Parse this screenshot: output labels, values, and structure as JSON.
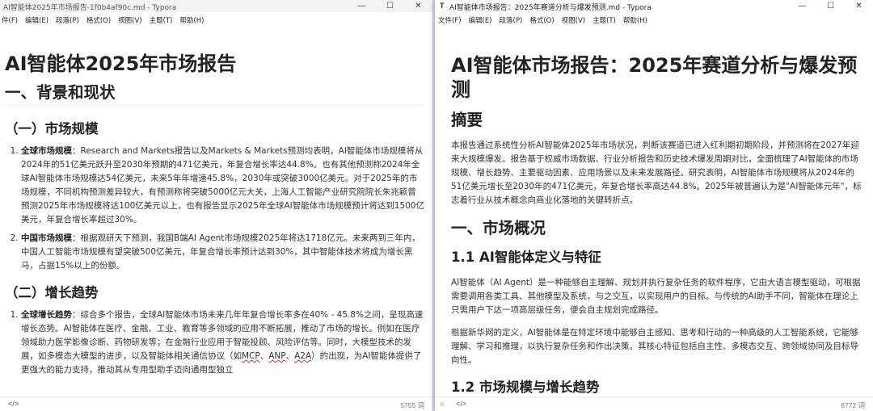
{
  "left_window": {
    "title": "AI智能体2025年市场报告-1f0b4af90c.md - Typora",
    "menu": [
      "件(F)",
      "编辑(E)",
      "段落(P)",
      "格式(O)",
      "视图(V)",
      "主题(T)",
      "帮助(H)"
    ],
    "doc": {
      "h1": "AI智能体2025年市场报告",
      "h2": "一、背景和现状",
      "h3_market": "（一）市场规模",
      "items_market": [
        {
          "label": "全球市场规模",
          "text": "：Research and Markets报告以及Markets & Markets预测均表明，AI智能体市场规模将从2024年的51亿美元跃升至2030年预期的471亿美元，年复合增长率达44.8%。也有其他预测称2024年全球AI智能体市场规模达54亿美元，未来5年年增速45.8%，2030年或突破3000亿美元。对于2025年的市场规模，不同机构预测差异较大，有预测称将突破5000亿元大关，上海人工智能产业研究院院长朱兆颖曾预测2025年市场规模将达100亿美元以上，也有报告显示2025年全球AI智能体市场规模预计将达到1500亿美元，年复合增长率超过30%。"
        },
        {
          "label": "中国市场规模",
          "text": "：根据观研天下预测，我国B端AI Agent市场规模2025年将达1718亿元。未来两到三年内，中国人工智能市场规模有望突破500亿美元，年复合增长率预计达到30%，其中智能体技术将成为增长黑马，占据15%以上的份额。"
        }
      ],
      "h3_growth": "（二）增长趋势",
      "item_growth": {
        "label": "全球增长趋势",
        "text_a": "：综合多个报告，全球AI智能体市场未来几年年复合增长率多在40% - 45.8%之间，呈现高速增长态势。AI智能体在医疗、金融、工业、教育等多领域的应用不断拓展，推动了市场的增长。例如在医疗领域助力医学影像诊断、药物研发等；在金融行业应用于智能投顾、风险评估等。同时，大模型技术的发展，如多模态大模型的进步，以及智能体相关通信协议（如",
        "mcp": "MCP",
        "sep1": "、",
        "anp": "ANP",
        "sep2": "、",
        "a2a": "A2A",
        "text_b": "）的出现，为AI智能体提供了更强大的能力支持，推动其从专用型助手迈向通用型独立"
      }
    },
    "status": {
      "source_icon": "</>",
      "word_count": "5755 词"
    }
  },
  "right_window": {
    "title": "AI智能体市场报告：2025年赛道分析与爆发预测.md - Typora",
    "app_icon": "T",
    "menu": [
      "文件(F)",
      "编辑(E)",
      "段落(P)",
      "格式(O)",
      "视图(V)",
      "主题(T)",
      "帮助(H)"
    ],
    "doc": {
      "h1": "AI智能体市场报告：2025年赛道分析与爆发预测",
      "h2_summary": "摘要",
      "summary": "本报告通过系统性分析AI智能体2025年市场状况，判断该赛道已进入红利期初期阶段，并预测将在2027年迎来大规模爆发。报告基于权威市场数据、行业分析报告和历史技术爆发周期对比，全面梳理了AI智能体的市场规模、增长趋势、主要驱动因素、应用场景以及未来发展路径。研究表明，AI智能体市场规模将从2024年的51亿美元增长至2030年的471亿美元，年复合增长率高达44.8%。2025年被普遍认为是\"AI智能体元年\"，标志着行业从技术概念向商业化落地的关键转折点。",
      "h2_overview": "一、市场概况",
      "h3_definition": "1.1 AI智能体定义与特征",
      "definition_p1": "AI智能体（AI Agent）是一种能够自主理解、规划并执行复杂任务的软件程序，它由大语言模型驱动，可根据需要调用各类工具、其他模型及系统，与之交互，以实现用户的目标。与传统的AI助手不同，智能体在理论上只需用户下达一项高层级任务，便会自主规划完成路径。",
      "definition_p2": "根据新华网的定义，AI智能体是在特定环境中能够自主感知、思考和行动的一种高级的人工智能系统，它能够理解、学习和推理，以执行复杂任务和作出决策。其核心特征包括自主性、多模态交互、跨领域协同及目标导向性。",
      "h3_next": "1.2 市场规模与增长趋势"
    },
    "status": {
      "source_icon": "</>",
      "word_count": "6772 词"
    }
  },
  "window_controls": {
    "minimize": "—",
    "maximize": "☐",
    "close": "✕"
  },
  "icons": {
    "circle_icon": "○"
  }
}
